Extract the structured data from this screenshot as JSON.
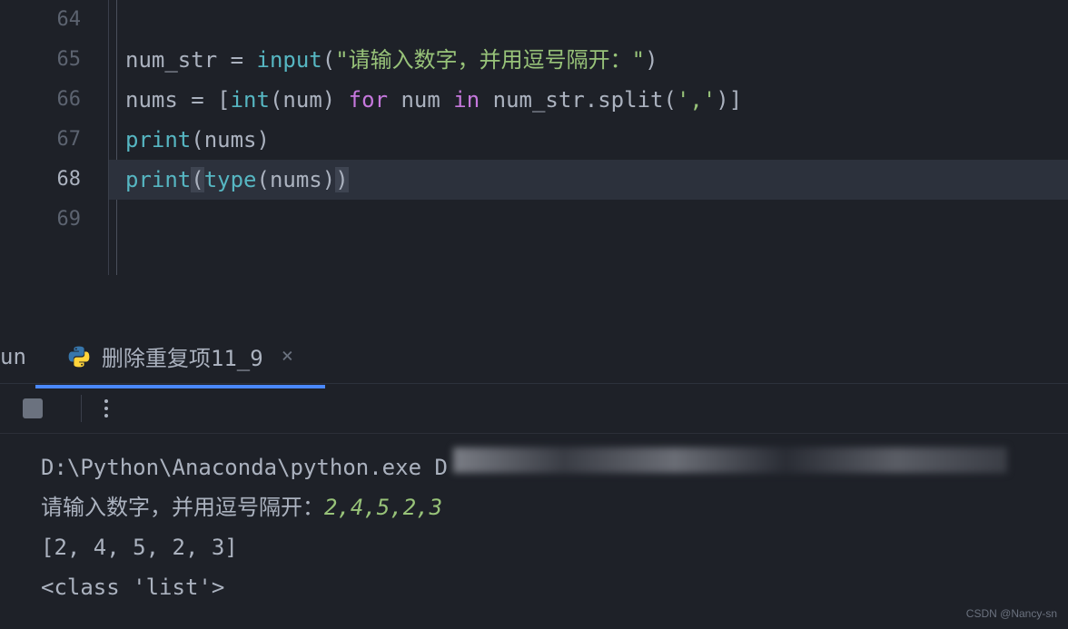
{
  "editor": {
    "lines": [
      {
        "number": "64",
        "current": false,
        "highlighted": false,
        "tokens": []
      },
      {
        "number": "65",
        "current": false,
        "highlighted": false,
        "tokens": [
          {
            "cls": "tok-default",
            "text": "num_str "
          },
          {
            "cls": "tok-operator",
            "text": "="
          },
          {
            "cls": "tok-default",
            "text": " "
          },
          {
            "cls": "tok-builtin",
            "text": "input"
          },
          {
            "cls": "tok-default",
            "text": "("
          },
          {
            "cls": "tok-string",
            "text": "\"请输入数字，并用逗号隔开：\""
          },
          {
            "cls": "tok-default",
            "text": ")"
          }
        ]
      },
      {
        "number": "66",
        "current": false,
        "highlighted": false,
        "tokens": [
          {
            "cls": "tok-default",
            "text": "nums "
          },
          {
            "cls": "tok-operator",
            "text": "="
          },
          {
            "cls": "tok-default",
            "text": " ["
          },
          {
            "cls": "tok-builtin",
            "text": "int"
          },
          {
            "cls": "tok-default",
            "text": "(num) "
          },
          {
            "cls": "tok-keyword",
            "text": "for"
          },
          {
            "cls": "tok-default",
            "text": " num "
          },
          {
            "cls": "tok-keyword",
            "text": "in"
          },
          {
            "cls": "tok-default",
            "text": " num_str.split("
          },
          {
            "cls": "tok-string",
            "text": "','"
          },
          {
            "cls": "tok-default",
            "text": ")]"
          }
        ]
      },
      {
        "number": "67",
        "current": false,
        "highlighted": false,
        "tokens": [
          {
            "cls": "tok-builtin",
            "text": "print"
          },
          {
            "cls": "tok-default",
            "text": "(nums)"
          }
        ]
      },
      {
        "number": "68",
        "current": true,
        "highlighted": true,
        "tokens": [
          {
            "cls": "tok-builtin",
            "text": "print"
          },
          {
            "cls": "tok-default tok-paren-hl",
            "text": "("
          },
          {
            "cls": "tok-builtin",
            "text": "type"
          },
          {
            "cls": "tok-default",
            "text": "(nums)"
          },
          {
            "cls": "tok-default tok-paren-hl",
            "text": ")"
          }
        ]
      },
      {
        "number": "69",
        "current": false,
        "highlighted": false,
        "tokens": []
      }
    ]
  },
  "run": {
    "label": "un",
    "tab_title": "删除重复项11_9",
    "close_glyph": "×"
  },
  "console": {
    "exe_path": "D:\\Python\\Anaconda\\python.exe D",
    "prompt": "请输入数字，并用逗号隔开：",
    "user_input": "2,4,5,2,3",
    "out1": "[2, 4, 5, 2, 3]",
    "out2": "<class 'list'>"
  },
  "watermark": "CSDN @Nancy-sn"
}
